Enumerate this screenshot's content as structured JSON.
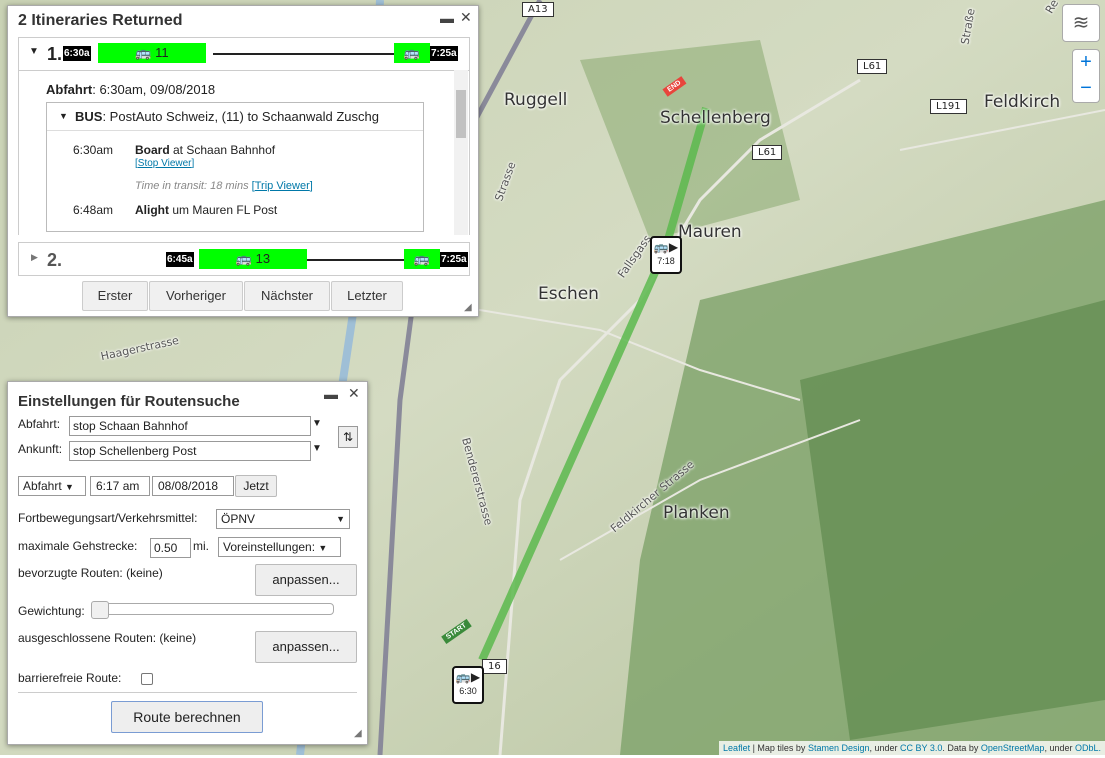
{
  "map": {
    "towns": [
      "Ruggell",
      "Schellenberg",
      "Feldkirch",
      "Mauren",
      "Eschen",
      "Planken"
    ],
    "streets": [
      "Haagerstrasse",
      "Bendererstrasse",
      "Fallsgass",
      "Feldkircher Strasse",
      "Strasse",
      "Straße",
      "Re"
    ],
    "road_shields": [
      "A13",
      "L61",
      "L191",
      "L61",
      "16"
    ],
    "stop_markers": [
      {
        "time": "7:18"
      },
      {
        "time": "6:30"
      }
    ],
    "start_label": "START",
    "end_label": "END",
    "route_color": "#5cb84d"
  },
  "itineraries": {
    "title": "2 Itineraries Returned",
    "minimize_icon": "minimize-icon",
    "close_icon": "close-icon",
    "items": [
      {
        "index": "1.",
        "start": "6:30a",
        "bus": "11",
        "end": "7:25a"
      },
      {
        "index": "2.",
        "start": "6:45a",
        "bus": "13",
        "end": "7:25a"
      }
    ],
    "departure_label": "Abfahrt",
    "departure_value": ": 6:30am, 09/08/2018",
    "leg_header_label": "BUS",
    "leg_header_value": ": PostAuto Schweiz, (11) to Schaanwald Zuschg",
    "board_time": "6:30am",
    "board_label": "Board",
    "board_place": " at Schaan Bahnhof",
    "stop_viewer": "Stop Viewer",
    "transit_text": "Time in transit: 18 mins",
    "trip_viewer": "Trip Viewer",
    "alight_time": "6:48am",
    "alight_label": "Alight",
    "alight_place": " um Mauren FL Post",
    "nav": [
      "Erster",
      "Vorheriger",
      "Nächster",
      "Letzter"
    ]
  },
  "settings": {
    "title": "Einstellungen für Routensuche",
    "from_label": "Abfahrt:",
    "from_value": "stop Schaan Bahnhof",
    "to_label": "Ankunft:",
    "to_value": "stop Schellenberg Post",
    "time_mode": "Abfahrt",
    "time_value": "6:17 am",
    "date_value": "08/08/2018",
    "now_button": "Jetzt",
    "mode_label": "Fortbewegungsart/Verkehrsmittel:",
    "mode_value": "ÖPNV",
    "walk_label": "maximale Gehstrecke:",
    "walk_value": "0.50",
    "walk_unit": "mi.",
    "preset_value": "Voreinstellungen:",
    "preferred_label": "bevorzugte Routen: (keine)",
    "customize_label": "anpassen...",
    "weighting_label": "Gewichtung:",
    "excluded_label": "ausgeschlossene Routen: (keine)",
    "accessible_label": "barrierefreie Route:",
    "submit_label": "Route berechnen"
  },
  "attribution": {
    "leaflet": "Leaflet",
    "text1": " | Map tiles by ",
    "stamen": "Stamen Design",
    "text2": ", under ",
    "ccby": "CC BY 3.0",
    "text3": ". Data by ",
    "osm": "OpenStreetMap",
    "text4": ", under ",
    "odbl": "ODbL."
  }
}
